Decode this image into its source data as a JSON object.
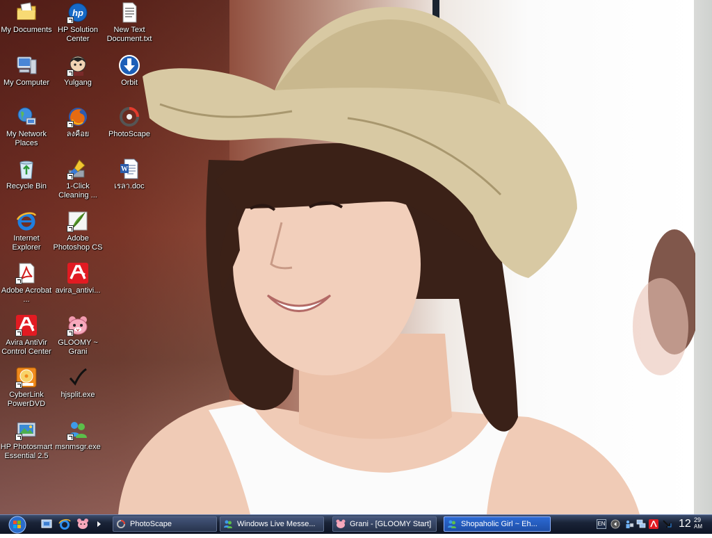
{
  "desktop": {
    "icons": [
      {
        "label": "My Documents",
        "icon": "folder-documents-icon",
        "shortcut": false
      },
      {
        "label": "HP Solution Center",
        "icon": "hp-logo-icon",
        "shortcut": true
      },
      {
        "label": "New Text Document.txt",
        "icon": "text-file-icon",
        "shortcut": false
      },
      {
        "label": "My Computer",
        "icon": "computer-icon",
        "shortcut": false
      },
      {
        "label": "Yulgang",
        "icon": "game-character-icon",
        "shortcut": true
      },
      {
        "label": "Orbit",
        "icon": "download-arrow-icon",
        "shortcut": false
      },
      {
        "label": "My Network Places",
        "icon": "network-globe-icon",
        "shortcut": false
      },
      {
        "label": "ลงคือย",
        "icon": "firefox-icon",
        "shortcut": true
      },
      {
        "label": "PhotoScape",
        "icon": "photoscape-icon",
        "shortcut": false
      },
      {
        "label": "Recycle Bin",
        "icon": "recycle-bin-icon",
        "shortcut": false
      },
      {
        "label": "1-Click Cleaning ...",
        "icon": "cleaning-brush-icon",
        "shortcut": true
      },
      {
        "label": "เรลา.doc",
        "icon": "word-document-icon",
        "shortcut": false
      },
      {
        "label": "Internet Explorer",
        "icon": "internet-explorer-icon",
        "shortcut": false
      },
      {
        "label": "Adobe Photoshop CS",
        "icon": "photoshop-feather-icon",
        "shortcut": true
      },
      {
        "label": "Adobe Acrobat ...",
        "icon": "acrobat-icon",
        "shortcut": true
      },
      {
        "label": "avira_antivi...",
        "icon": "avira-umbrella-icon",
        "shortcut": false
      },
      {
        "label": "Avira AntiVir Control Center",
        "icon": "avira-umbrella-icon",
        "shortcut": true
      },
      {
        "label": "GLOOMY ~ Grani",
        "icon": "gloomy-bear-icon",
        "shortcut": true
      },
      {
        "label": "CyberLink PowerDVD",
        "icon": "powerdvd-icon",
        "shortcut": true
      },
      {
        "label": "hjsplit.exe",
        "icon": "checkmark-icon",
        "shortcut": false
      },
      {
        "label": "HP Photosmart Essential 2.5",
        "icon": "hp-photosmart-icon",
        "shortcut": true
      },
      {
        "label": "msnmsgr.exe",
        "icon": "msn-messenger-icon",
        "shortcut": true
      }
    ]
  },
  "taskbar": {
    "start_icon": "windows-start-orb-icon",
    "quick_launch": [
      "show-desktop-icon",
      "internet-explorer-icon",
      "gloomy-bear-icon"
    ],
    "expand_arrow": "chevron-right-icon",
    "tasks": [
      {
        "label": "PhotoScape",
        "icon": "photoscape-icon",
        "active": false
      },
      {
        "label": "Windows Live Messe...",
        "icon": "msn-messenger-icon",
        "active": false
      },
      {
        "label": "Grani - [GLOOMY Start]",
        "icon": "gloomy-bear-icon",
        "active": false
      },
      {
        "label": "Shopaholic Girl ~ Eh...",
        "icon": "msn-messenger-icon",
        "active": true
      }
    ],
    "tray": {
      "language": "EN",
      "icons": [
        "back-arrow-icon",
        "network-users-icon",
        "network-connection-icon",
        "avira-umbrella-icon",
        "download-arrow-icon"
      ],
      "clock": {
        "hour": "12",
        "minute": "29",
        "ampm": "AM"
      }
    }
  },
  "colors": {
    "taskbar_bg": "#1a2438",
    "active_task": "#2c6ad4",
    "label_text": "#ffffff"
  }
}
